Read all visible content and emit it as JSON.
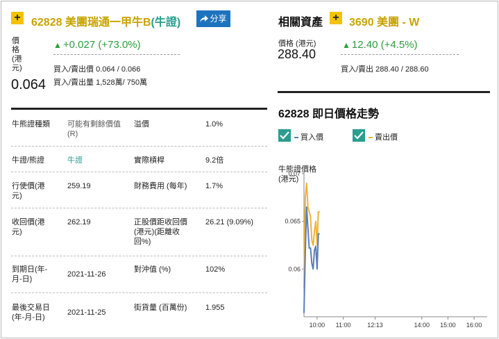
{
  "warrant": {
    "plus": "+",
    "code": "62828",
    "name": "美團瑞通一甲牛B",
    "type": "(牛證)",
    "share_label": "分享",
    "price_label": "價格(港元)",
    "price": "0.064",
    "change": "+0.027 (+73.0%)",
    "bid_ask_price_label": "買入/賣出價",
    "bid_ask_price": "0.064 / 0.066",
    "bid_ask_vol_label": "買入/賣出量",
    "bid_ask_vol": "1,528萬/ 750萬"
  },
  "related": {
    "section_label": "相關資產",
    "plus": "+",
    "name": "3690 美團 - W",
    "price_label": "價格 (港元)",
    "price": "288.40",
    "change": "12.40 (+4.5%)",
    "bid_ask_label": "買入/賣出",
    "bid_ask": "288.40 / 288.60"
  },
  "table": {
    "rows": [
      {
        "k1": "牛熊證種類",
        "v1": "可能有剩餘價值(R)",
        "k2": "溢價",
        "v2": "1.0%"
      },
      {
        "k1": "牛證/熊證",
        "v1": "牛證",
        "k2": "實際槓桿",
        "v2": "9.2倍"
      },
      {
        "k1": "行使價(港元)",
        "v1": "259.19",
        "k2": "財務費用 (每年)",
        "v2": "1.7%"
      },
      {
        "k1": "收回價(港元)",
        "v1": "262.19",
        "k2": "正股價距收回價(港元)(距離收回%)",
        "v2": "26.21 (9.09%)"
      },
      {
        "k1": "到期日(年-月-日)",
        "v1": "2021-11-26",
        "k2": "對沖值 (%)",
        "v2": "102%"
      },
      {
        "k1": "最後交易日(年-月-日)",
        "v1": "2021-11-25",
        "k2": "街貨量 (百萬份)",
        "v2": "1.955"
      }
    ]
  },
  "chart": {
    "title": "62828 即日價格走勢",
    "legend_bid": "買入價",
    "legend_ask": "賣出價",
    "ylabel_1": "牛熊證價格",
    "ylabel_2": "(港元)",
    "bid_color": "#5b7db8",
    "ask_color": "#f2b233"
  },
  "chart_data": {
    "type": "line",
    "ylabel": "牛熊證價格 (港元)",
    "ylim": [
      0.055,
      0.07
    ],
    "yticks": [
      "0.07",
      "0.065",
      "0.06"
    ],
    "xlim": [
      "09:30",
      "16:30"
    ],
    "xticks": [
      "10:00",
      "11:00",
      "12:13",
      "14:00",
      "15:00",
      "16:00"
    ],
    "series": [
      {
        "name": "買入價",
        "x": [
          "09:30",
          "09:33",
          "09:36",
          "09:39",
          "09:42",
          "09:45",
          "09:48",
          "09:51",
          "09:54",
          "09:57",
          "10:00",
          "10:03",
          "10:06"
        ],
        "values": [
          0.0554,
          0.0618,
          0.0665,
          0.0643,
          0.0622,
          0.0622,
          0.0606,
          0.06,
          0.062,
          0.0624,
          0.06,
          0.0637,
          0.0637
        ]
      },
      {
        "name": "賣出價",
        "x": [
          "09:30",
          "09:33",
          "09:36",
          "09:39",
          "09:42",
          "09:45",
          "09:48",
          "09:51",
          "09:54",
          "09:57",
          "10:00",
          "10:03",
          "10:06"
        ],
        "values": [
          0.058,
          0.0675,
          0.069,
          0.0665,
          0.066,
          0.0655,
          0.063,
          0.0625,
          0.064,
          0.065,
          0.0625,
          0.066,
          0.066
        ]
      }
    ]
  }
}
